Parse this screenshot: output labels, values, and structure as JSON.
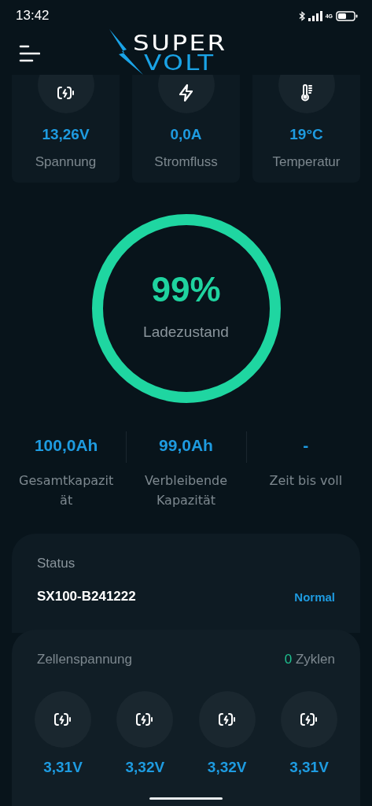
{
  "status_bar": {
    "time": "13:42",
    "network": "4G"
  },
  "header": {
    "logo_top": "SUPER",
    "logo_bottom": "VOLT"
  },
  "metrics": [
    {
      "kind": "battery",
      "value": "13,26V",
      "label": "Spannung"
    },
    {
      "kind": "bolt",
      "value": "0,0A",
      "label": "Stromfluss"
    },
    {
      "kind": "thermometer",
      "value": "19°C",
      "label": "Temperatur"
    }
  ],
  "gauge": {
    "value": "99%",
    "label": "Ladezustand"
  },
  "stats": [
    {
      "value": "100,0Ah",
      "label": "Gesamtkapazität"
    },
    {
      "value": "99,0Ah",
      "label": "Verbleibende Kapazität"
    },
    {
      "value": "-",
      "label": "Zeit bis voll"
    }
  ],
  "status_card": {
    "title": "Status",
    "device": "SX100-B241222",
    "state": "Normal"
  },
  "cells_card": {
    "title": "Zellenspannung",
    "cycles_count": "0",
    "cycles_label": "Zyklen",
    "cells": [
      {
        "value": "3,31V"
      },
      {
        "value": "3,32V"
      },
      {
        "value": "3,32V"
      },
      {
        "value": "3,31V"
      }
    ]
  }
}
